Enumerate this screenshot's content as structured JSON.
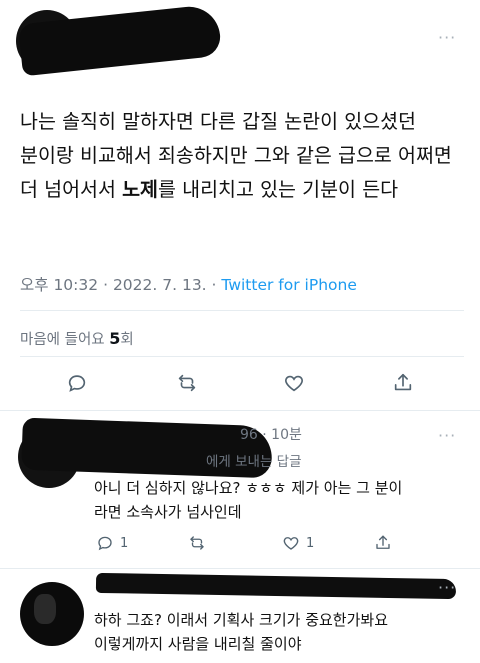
{
  "tweet": {
    "text_before": "나는 솔직히 말하자면 다른 갑질 논란이 있으셨던 분이랑 비교해서 죄송하지만 그와 같은 급으로 어쩌면 더 넘어서서 ",
    "text_bold": "노제",
    "text_after": "를 내리치고 있는 기분이 든다",
    "time": "오후 10:32",
    "date": "2022. 7. 13.",
    "separator": "·",
    "source": "Twitter for iPhone",
    "likes_label": "마음에 들어요",
    "likes_count": "5",
    "likes_unit": "회"
  },
  "replies": [
    {
      "time": "96 · 10분",
      "replying_to": "에게 보내는 답글",
      "line1": "아니 더 심하지 않나요? ㅎㅎㅎ 제가 아는 그 분이",
      "line2": "라면 소속사가 넘사인데",
      "reply_count": "1",
      "like_count": "1"
    },
    {
      "line1": "하하 그죠? 이래서 기획사 크기가 중요한가봐요",
      "line2": "이렇게까지 사람을 내리칠 줄이야"
    }
  ],
  "icons": {
    "more": "more-horizontal-icon",
    "reply": "reply-icon",
    "retweet": "retweet-icon",
    "like": "heart-icon",
    "share": "share-icon"
  },
  "colors": {
    "link": "#1d9bf0",
    "muted": "#6e7681",
    "text": "#0f1419"
  },
  "more_glyph": "···"
}
